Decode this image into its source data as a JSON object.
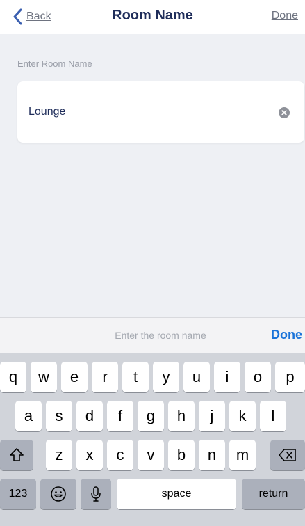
{
  "nav": {
    "back_label": "Back",
    "title": "Room Name",
    "done_label": "Done"
  },
  "form": {
    "section_label": "Enter Room Name",
    "room_name_value": "Lounge"
  },
  "accessory": {
    "hint": "Enter the room name",
    "done_label": "Done"
  },
  "keyboard": {
    "row1": [
      "q",
      "w",
      "e",
      "r",
      "t",
      "y",
      "u",
      "i",
      "o",
      "p"
    ],
    "row2": [
      "a",
      "s",
      "d",
      "f",
      "g",
      "h",
      "j",
      "k",
      "l"
    ],
    "row3": [
      "z",
      "x",
      "c",
      "v",
      "b",
      "n",
      "m"
    ],
    "numbers_label": "123",
    "space_label": "space",
    "return_label": "return",
    "icons": {
      "shift": "shift-icon",
      "backspace": "backspace-icon",
      "emoji": "emoji-icon",
      "mic": "microphone-icon"
    }
  },
  "colors": {
    "accent": "#1a73d9",
    "title": "#1f2d5a",
    "background": "#eef0f4",
    "keyboard_bg": "#d1d4da"
  }
}
